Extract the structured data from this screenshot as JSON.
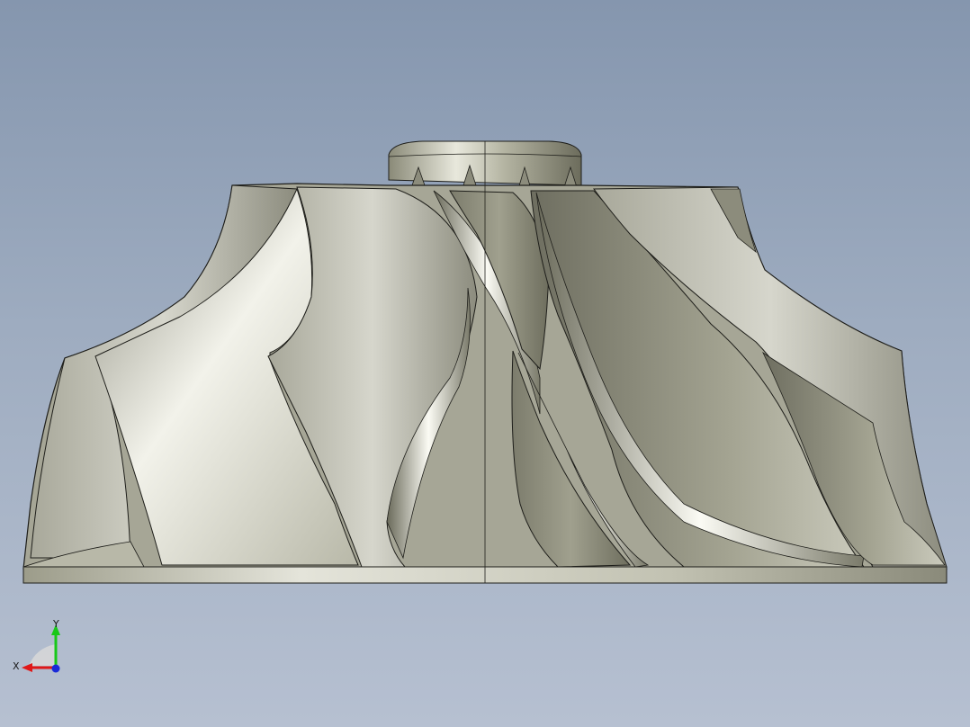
{
  "viewport": {
    "background_top": "#8596ae",
    "background_bottom": "#b6c0d1"
  },
  "model": {
    "name": "impeller-model",
    "surface_color": "#c9c8b8",
    "shadow_color": "#6e6e5e",
    "edge_color": "#1e1e1a"
  },
  "triad": {
    "x_label": "X",
    "y_label": "Y",
    "x_color": "#e01818",
    "y_color": "#18c818",
    "z_color": "#1a2ad8"
  }
}
